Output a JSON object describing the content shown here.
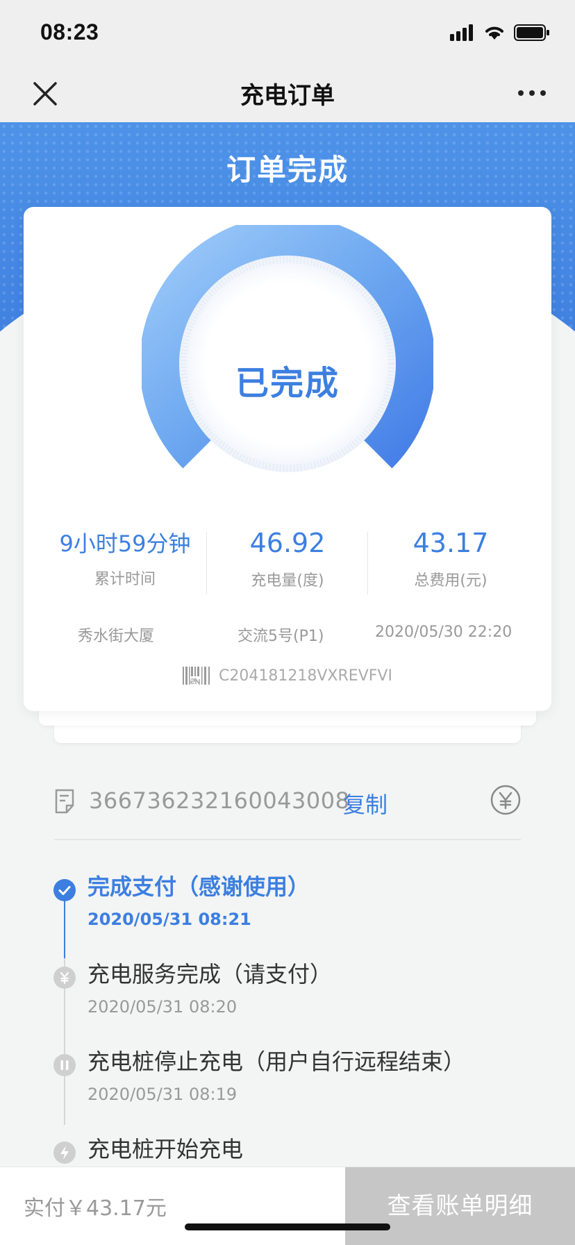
{
  "status_bar": {
    "time": "08:23"
  },
  "nav": {
    "title": "充电订单"
  },
  "header": {
    "title": "订单完成"
  },
  "card": {
    "status_label": "已完成",
    "stats": [
      {
        "value": "9小时59分钟",
        "label": "累计时间"
      },
      {
        "value": "46.92",
        "label": "充电量(度)"
      },
      {
        "value": "43.17",
        "label": "总费用(元)"
      }
    ],
    "station": "秀水街大厦",
    "pile": "交流5号(P1)",
    "datetime": "2020/05/30 22:20",
    "serial": "C204181218VXREVFVI"
  },
  "order": {
    "number": "366736232160043008",
    "copy_label": "复制"
  },
  "timeline": [
    {
      "title": "完成支付（感谢使用）",
      "time": "2020/05/31 08:21",
      "icon": "check-icon",
      "active": true
    },
    {
      "title": "充电服务完成（请支付）",
      "time": "2020/05/31 08:20",
      "icon": "yuan-icon",
      "active": false
    },
    {
      "title": "充电桩停止充电（用户自行远程结束）",
      "time": "2020/05/31 08:19",
      "icon": "pause-icon",
      "active": false
    },
    {
      "title": "充电桩开始充电",
      "time": "",
      "icon": "bolt-icon",
      "active": false
    }
  ],
  "bottom": {
    "pay_text": "实付￥43.17元",
    "bill_button": "查看账单明细"
  },
  "colors": {
    "primary": "#3c7fe0",
    "header_bg": "#4e93e8",
    "muted": "#999999",
    "button_disabled": "#c6c6c6"
  }
}
